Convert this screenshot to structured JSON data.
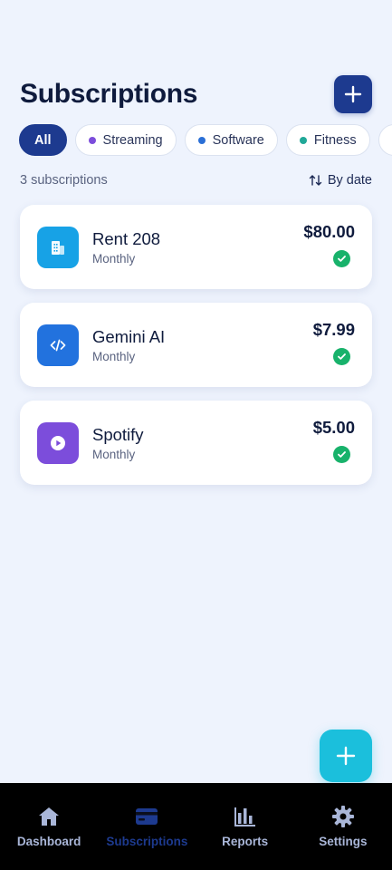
{
  "header": {
    "title": "Subscriptions"
  },
  "filters": [
    {
      "label": "All",
      "active": true
    },
    {
      "label": "Streaming",
      "dot": "#7c4ddb"
    },
    {
      "label": "Software",
      "dot": "#2a6fd6"
    },
    {
      "label": "Fitness",
      "dot": "#20a898"
    },
    {
      "label": "",
      "dot": "#e0354b"
    }
  ],
  "summary": {
    "count": "3 subscriptions",
    "sort": "By date"
  },
  "subscriptions": [
    {
      "name": "Rent 208",
      "cycle": "Monthly",
      "price": "$80.00",
      "icon": "building-icon",
      "color": "#17a2e6"
    },
    {
      "name": "Gemini AI",
      "cycle": "Monthly",
      "price": "$7.99",
      "icon": "code-icon",
      "color": "#2272de"
    },
    {
      "name": "Spotify",
      "cycle": "Monthly",
      "price": "$5.00",
      "icon": "play-icon",
      "color": "#7c4ddb"
    }
  ],
  "nav": [
    {
      "label": "Dashboard",
      "icon": "home-icon"
    },
    {
      "label": "Subscriptions",
      "icon": "card-icon",
      "active": true
    },
    {
      "label": "Reports",
      "icon": "bar-chart-icon"
    },
    {
      "label": "Settings",
      "icon": "gear-icon"
    }
  ],
  "colors": {
    "accent": "#1d3a8f",
    "fab": "#1bbfdc",
    "paid": "#18b26b",
    "background": "#eef3fd"
  }
}
